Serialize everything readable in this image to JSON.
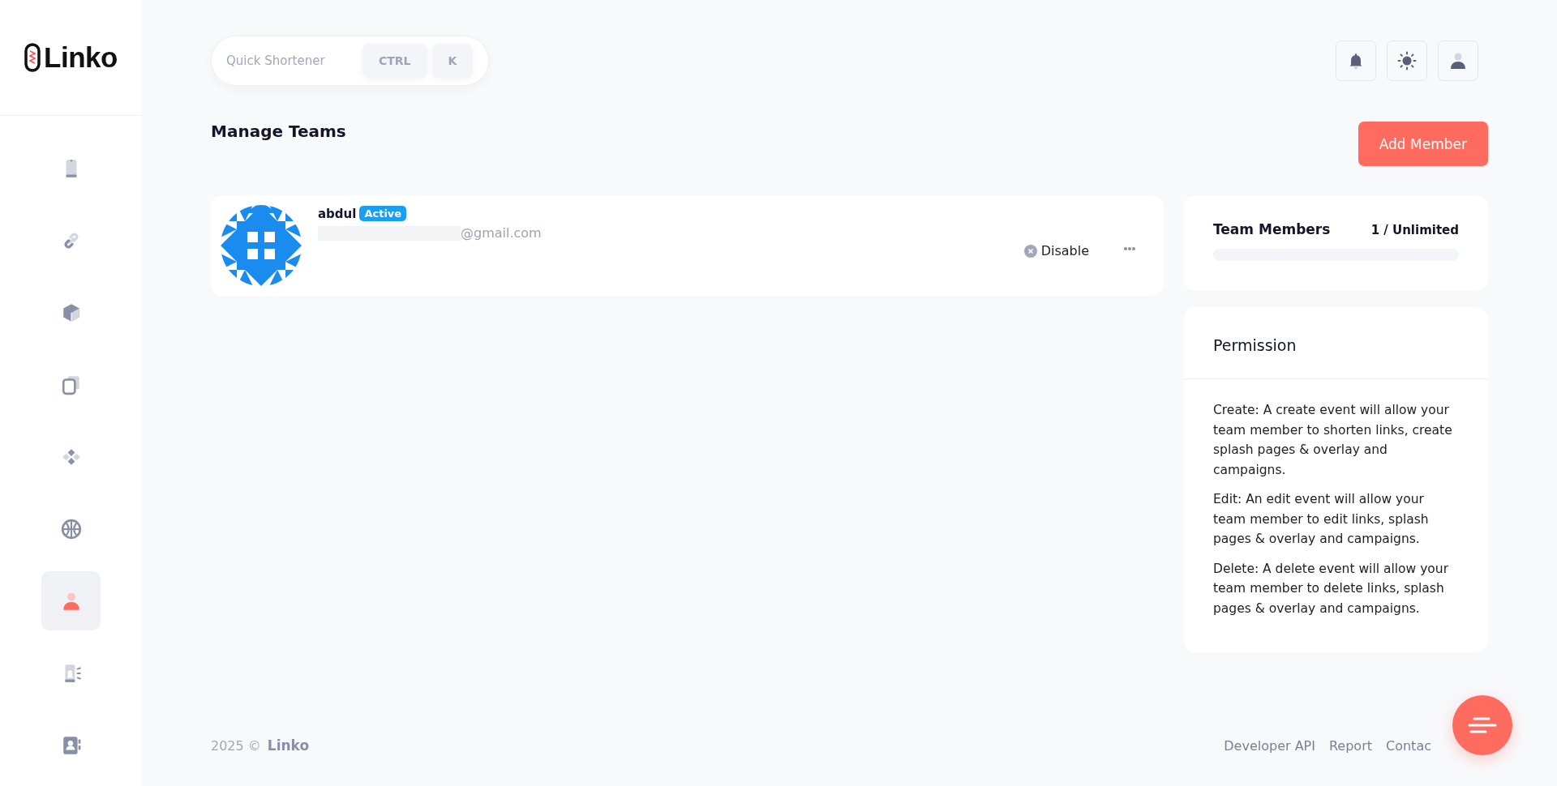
{
  "brand": {
    "logo_text": "Linko"
  },
  "sidebar": {
    "items": [
      {
        "kind": "phone",
        "selected": false
      },
      {
        "kind": "link",
        "selected": false
      },
      {
        "kind": "cube",
        "selected": false
      },
      {
        "kind": "copy",
        "selected": false
      },
      {
        "kind": "diamonds",
        "selected": false
      },
      {
        "kind": "globe",
        "selected": false
      },
      {
        "kind": "user",
        "selected": true
      },
      {
        "kind": "alert",
        "selected": false
      },
      {
        "kind": "contacts",
        "selected": false
      }
    ]
  },
  "quick_search": {
    "placeholder": "Quick Shortener",
    "keys": [
      "CTRL",
      "K"
    ]
  },
  "header_actions": [
    {
      "kind": "bell"
    },
    {
      "kind": "sun"
    },
    {
      "kind": "user"
    }
  ],
  "page_title": "Manage Teams",
  "add_button": "Add Member",
  "members": [
    {
      "name": "abdul",
      "status": "Active",
      "email": "@gmail.com",
      "action": "Disable"
    }
  ],
  "team_members": {
    "title": "Team Members",
    "count": "1 / Unlimited",
    "level": 0
  },
  "permission": {
    "title": "Permission",
    "paragraphs": [
      "Create: A create event will allow your team member to shorten links, create splash pages & overlay and campaigns.",
      "Edit: An edit event will allow your team member to edit links, splash pages & overlay and campaigns.",
      "Delete: A delete event will allow your team member to delete links, splash pages & overlay and campaigns."
    ]
  },
  "footer": {
    "year": "2025 ©",
    "brand": "Linko",
    "links": [
      "Developer API",
      "Report",
      "Contac"
    ]
  }
}
